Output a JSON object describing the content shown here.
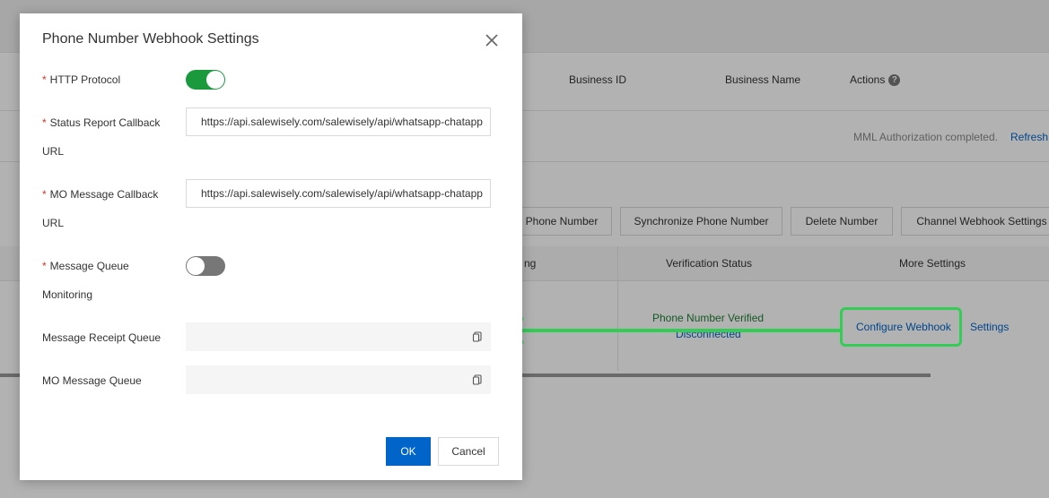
{
  "background": {
    "table1_headers": {
      "business_id": "Business ID",
      "business_name": "Business Name",
      "actions": "Actions"
    },
    "status_text": "MML Authorization completed.",
    "refresh_link": "Refresh",
    "toolbar_buttons": [
      "Phone Number",
      "Synchronize Phone Number",
      "Delete Number",
      "Channel Webhook Settings"
    ],
    "table2_headers": {
      "partial": "ng",
      "verification_status": "Verification Status",
      "more_settings": "More Settings"
    },
    "row": {
      "verification_line1": "Phone Number Verified",
      "verification_line2": "Disconnected",
      "configure_webhook": "Configure Webhook",
      "settings": "Settings"
    }
  },
  "modal": {
    "title": "Phone Number Webhook Settings",
    "fields": {
      "http_protocol": {
        "label": "HTTP Protocol",
        "required": true,
        "enabled": true
      },
      "status_report_url": {
        "label_line1": "Status Report Callback",
        "label_line2": "URL",
        "required": true,
        "value": "https://api.salewisely.com/salewisely/api/whatsapp-chatapp"
      },
      "mo_message_url": {
        "label_line1": "MO Message Callback",
        "label_line2": "URL",
        "required": true,
        "value": "https://api.salewisely.com/salewisely/api/whatsapp-chatapp"
      },
      "mq_monitoring": {
        "label_line1": "Message Queue",
        "label_line2": "Monitoring",
        "required": true,
        "enabled": false
      },
      "receipt_queue": {
        "label": "Message Receipt Queue",
        "value": ""
      },
      "mo_queue": {
        "label": "MO Message Queue",
        "value": ""
      }
    },
    "required_mark": "*",
    "ok_label": "OK",
    "cancel_label": "Cancel"
  },
  "colors": {
    "primary": "#0064c8",
    "switch_on": "#1a9a3c",
    "highlight": "#33cc55"
  }
}
